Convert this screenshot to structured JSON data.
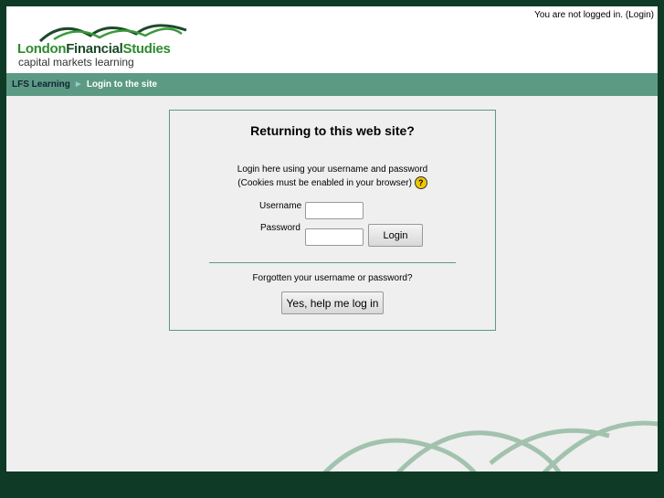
{
  "header": {
    "login_status": "You are not logged in.",
    "login_link": "(Login)",
    "logo": {
      "part1": "London",
      "part2": "Financial",
      "part3": "Studies",
      "tagline": "capital markets learning"
    }
  },
  "breadcrumb": {
    "home": "LFS Learning",
    "separator": "►",
    "current": "Login to the site"
  },
  "login": {
    "title": "Returning to this web site?",
    "desc1": "Login here using your username and password",
    "desc2": "(Cookies must be enabled in your browser)",
    "help_icon": "?",
    "username_label": "Username",
    "password_label": "Password",
    "username_value": "",
    "password_value": "",
    "login_button": "Login",
    "forgot_text": "Forgotten your username or password?",
    "forgot_button": "Yes, help me log in"
  },
  "colors": {
    "bg": "#0e3a26",
    "nav": "#5c9a84"
  }
}
